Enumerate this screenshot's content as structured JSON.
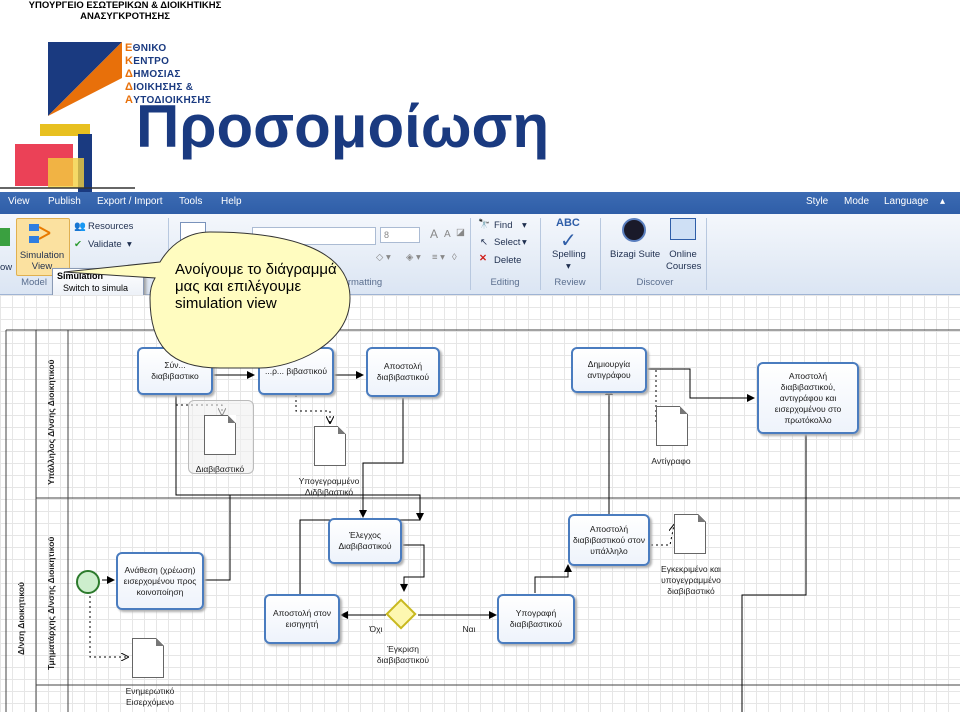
{
  "header": {
    "ministry_line1": "ΥΠΟΥΡΓΕΙΟ ΕΣΩΤΕΡΙΚΩΝ & ΔΙΟΙΚΗΤΙΚΗΣ",
    "ministry_line2": "ΑΝΑΣΥΓΚΡΟΤΗΣΗΣ",
    "logo_lines": [
      {
        "initial": "Ε",
        "rest": "ΘΝΙΚΟ"
      },
      {
        "initial": "Κ",
        "rest": "ΕΝΤΡΟ"
      },
      {
        "initial": "Δ",
        "rest": "ΗΜΟΣΙΑΣ"
      },
      {
        "initial": "Δ",
        "rest": "ΙΟΙΚΗΣΗΣ &"
      },
      {
        "initial": "Α",
        "rest": "ΥΤΟΔΙΟΙΚΗΣΗΣ"
      }
    ],
    "title": "Προσομοίωση"
  },
  "menu": {
    "left": [
      "View",
      "Publish",
      "Export / Import",
      "Tools",
      "Help"
    ],
    "right": [
      "Style",
      "Mode",
      "Language"
    ]
  },
  "ribbon": {
    "ow": "ow",
    "simulation_view": "Simulation View",
    "resources": "Resources",
    "validate": "Validate",
    "model_group": "Model",
    "font_size": "8",
    "formatting_group": "rmatting",
    "find": "Find",
    "select": "Select",
    "delete": "Delete",
    "editing_group": "Editing",
    "spelling": "Spelling",
    "review_group": "Review",
    "bizagi_suite": "Bizagi Suite",
    "online_courses": "Online Courses",
    "discover_group": "Discover",
    "tooltip_title": "Simulation",
    "tooltip_body": "Switch to simula"
  },
  "callout": "Ανοίγουμε το διάγραμμά μας και επιλέγουμε simulation view",
  "lanes": {
    "outer": "Δ/νση Διοικητικού",
    "employee": "Υπάλληλος Δ/νσης Διοικητικού",
    "head": "Τμηματάρχης Δ/νσης Διοικητικού"
  },
  "tasks": {
    "t1": "Σύν... διαβιβαστικο",
    "t2": "...ρ... βιβαστικού",
    "t3": "Αποστολή διαβιβαστικού",
    "t4": "Δημιουργία αντιγράφου",
    "t5": "Αποστολή διαβιβαστικού, αντιγράφου και εισερχομένου στο πρωτόκολλο",
    "t6": "Έλεγχος Διαβιβαστικού",
    "t7": "Αποστολή διαβιβαστικού στον υπάλληλο",
    "t8": "Ανάθεση (χρέωση) εισερχομένου προς κοινοποίηση",
    "t9": "Αποστολή στον εισηγητή",
    "t10": "Υπογραφή διαβιβαστικού"
  },
  "docs": {
    "d1": "Διαβιβαστικό",
    "d2": "Υπογεγραμμένο Διδβιβαστικό",
    "d3": "Αντίγραφο",
    "d4": "Εγκεκριμένο και υπογεγραμμένο διαβιβαστικό",
    "d5": "Ενημερωτικό Εισερχόμενο"
  },
  "gateway": {
    "label": "Έγκριση διαβιβαστικού",
    "no": "Όχι",
    "yes": "Ναι"
  }
}
